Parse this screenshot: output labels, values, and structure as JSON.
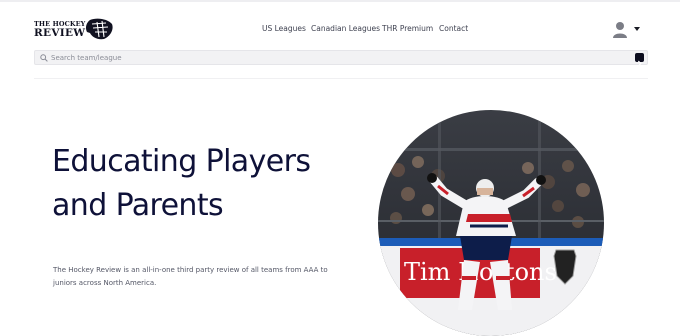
{
  "brand": {
    "logo_line1": "THE HOCKEY",
    "logo_line2": "REVIEW"
  },
  "nav": {
    "items": [
      {
        "label": "US Leagues"
      },
      {
        "label": "Canadian Leagues"
      },
      {
        "label": "THR Premium"
      },
      {
        "label": "Contact"
      }
    ]
  },
  "account": {
    "icon": "user-avatar-icon",
    "menu_icon": "caret-down-icon"
  },
  "search": {
    "placeholder": "Search team/league",
    "value": "",
    "submit_icon": "chevron-right-icon"
  },
  "hero": {
    "title": "Educating Players and Parents",
    "description": "The Hockey Review is an all-in-one third party review of all teams from AAA to juniors across North America.",
    "image_alt": "Hockey player celebrating with arms raised in front of a crowd"
  },
  "photo_board": {
    "sponsor": "Tim Hortons"
  },
  "colors": {
    "heading": "#0e1138",
    "accent_dark": "#0c0d1e"
  }
}
